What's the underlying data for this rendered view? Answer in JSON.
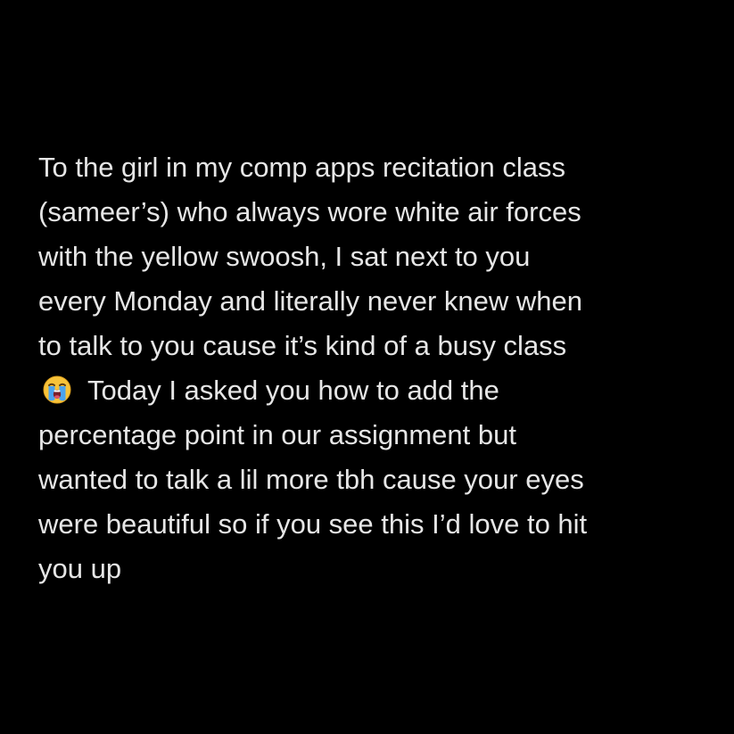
{
  "post": {
    "lines": [
      "To the girl in my comp apps recitation class",
      "(sameer’s) who always wore white air forces",
      "with the yellow swoosh, I sat next to you",
      "every Monday and literally never knew when",
      "to talk to you cause it’s kind of a busy class",
      "Today I asked you how to add the",
      "percentage point in our assignment but",
      "wanted to talk a lil more tbh cause your eyes",
      "were beautiful so if you see this I’d love to hit",
      "you up"
    ],
    "emoji": "loudly-crying-face-icon"
  },
  "colors": {
    "background": "#000000",
    "text": "#e6e6e6"
  }
}
